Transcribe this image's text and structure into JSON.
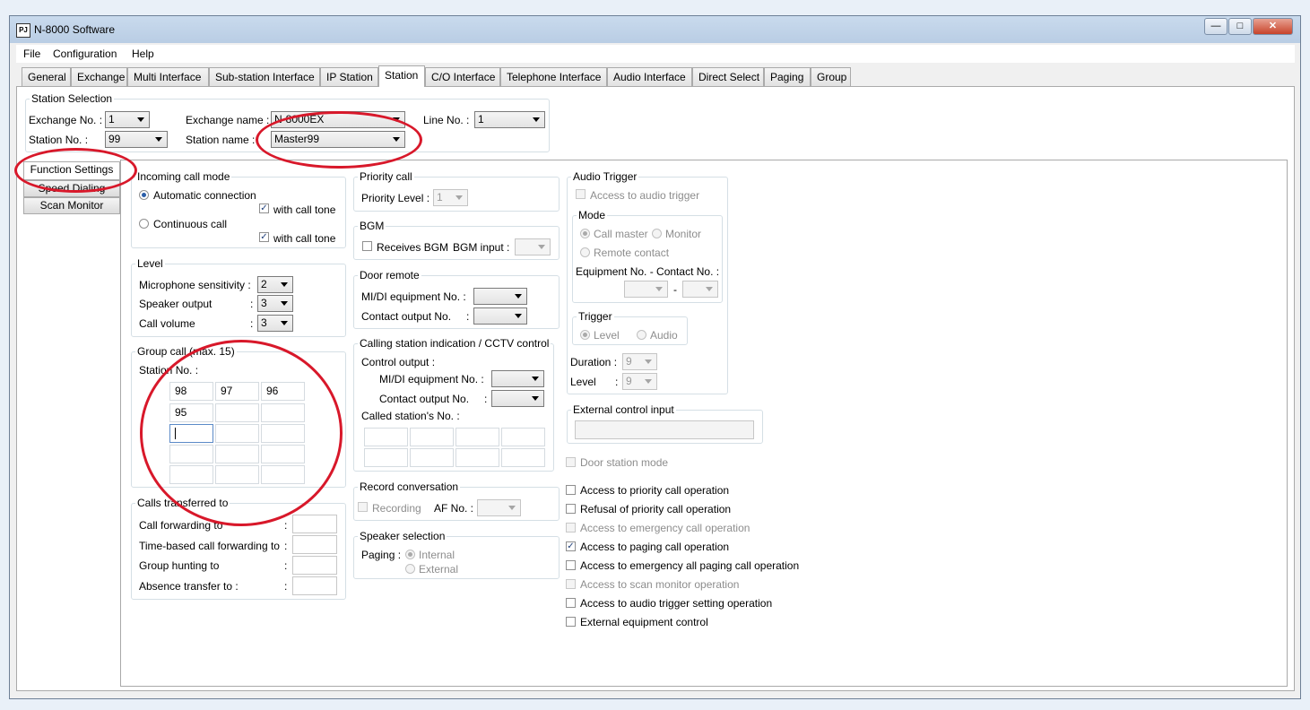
{
  "window": {
    "title": "N-8000 Software",
    "icon_text": "PJ",
    "minimize": "—",
    "maximize": "□",
    "close": "✕"
  },
  "menu": [
    "File",
    "Configuration",
    "Help"
  ],
  "tabs": [
    "General",
    "Exchange",
    "Multi Interface",
    "Sub-station Interface",
    "IP Station",
    "Station",
    "C/O Interface",
    "Telephone Interface",
    "Audio Interface",
    "Direct Select",
    "Paging",
    "Group"
  ],
  "active_tab": "Station",
  "station_selection": {
    "title": "Station Selection",
    "exchange_no_label": "Exchange No. :",
    "exchange_no": "1",
    "exchange_name_label": "Exchange name :",
    "exchange_name": "N-8000EX",
    "line_no_label": "Line No. :",
    "line_no": "1",
    "station_no_label": "Station No. :",
    "station_no": "99",
    "station_name_label": "Station name :",
    "station_name": "Master99"
  },
  "side_buttons": [
    "Function Settings",
    "Speed Dialing",
    "Scan Monitor"
  ],
  "incoming": {
    "title": "Incoming call mode",
    "auto": "Automatic connection",
    "tone1": "with call tone",
    "continuous": "Continuous call",
    "tone2": "with call tone"
  },
  "level": {
    "title": "Level",
    "mic_label": "Microphone sensitivity :",
    "mic": "2",
    "spk_label": "Speaker output",
    "spk": "3",
    "vol_label": "Call volume",
    "vol": "3",
    "colon": ":"
  },
  "group_call": {
    "title": "Group call (max. 15)",
    "station_label": "Station No. :",
    "cells": [
      "98",
      "97",
      "96",
      "95",
      "",
      "",
      "",
      "",
      "",
      "",
      "",
      "",
      "",
      "",
      ""
    ]
  },
  "transfer": {
    "title": "Calls transferred to",
    "items": [
      "Call forwarding to",
      "Time-based call forwarding to",
      "Group hunting to",
      "Absence transfer to :"
    ],
    "colon": ":"
  },
  "priority": {
    "title": "Priority call",
    "label": "Priority Level :",
    "value": "1"
  },
  "bgm": {
    "title": "BGM",
    "receives": "Receives BGM",
    "input_label": "BGM input :"
  },
  "door_remote": {
    "title": "Door remote",
    "midi": "MI/DI equipment No. :",
    "contact": "Contact output No.",
    "colon": ":"
  },
  "calling": {
    "title": "Calling station indication / CCTV control",
    "control_output": "Control output :",
    "midi": "MI/DI equipment No. :",
    "contact": "Contact output No.",
    "colon": ":",
    "called": "Called station's No. :"
  },
  "record": {
    "title": "Record conversation",
    "recording": "Recording",
    "af_label": "AF No. :"
  },
  "speaker": {
    "title": "Speaker selection",
    "paging_label": "Paging :",
    "internal": "Internal",
    "external": "External"
  },
  "audio_trigger": {
    "title": "Audio Trigger",
    "access": "Access to audio trigger",
    "mode_title": "Mode",
    "call_master": "Call master",
    "monitor": "Monitor",
    "remote": "Remote contact",
    "equip_label": "Equipment No. - Contact No. :",
    "dash": "-",
    "trigger_title": "Trigger",
    "level_opt": "Level",
    "audio_opt": "Audio",
    "duration_label": "Duration :",
    "duration": "9",
    "level_label": "Level",
    "level": "9",
    "colon": ":"
  },
  "external_control": {
    "title": "External control input"
  },
  "door_station_mode": "Door station mode",
  "access_options": [
    {
      "label": "Access to priority call operation",
      "checked": false,
      "enabled": true
    },
    {
      "label": "Refusal of priority call operation",
      "checked": false,
      "enabled": true
    },
    {
      "label": "Access to emergency call operation",
      "checked": false,
      "enabled": false
    },
    {
      "label": "Access to paging call operation",
      "checked": true,
      "enabled": true
    },
    {
      "label": "Access to emergency all paging call operation",
      "checked": false,
      "enabled": true
    },
    {
      "label": "Access to scan monitor operation",
      "checked": false,
      "enabled": false
    },
    {
      "label": "Access to audio trigger setting operation",
      "checked": false,
      "enabled": true
    },
    {
      "label": "External equipment control",
      "checked": false,
      "enabled": true
    }
  ],
  "colors": {
    "annotation": "#d8182a",
    "title_bar": "#c9daed",
    "checked_mark": "#1f3f7a"
  }
}
